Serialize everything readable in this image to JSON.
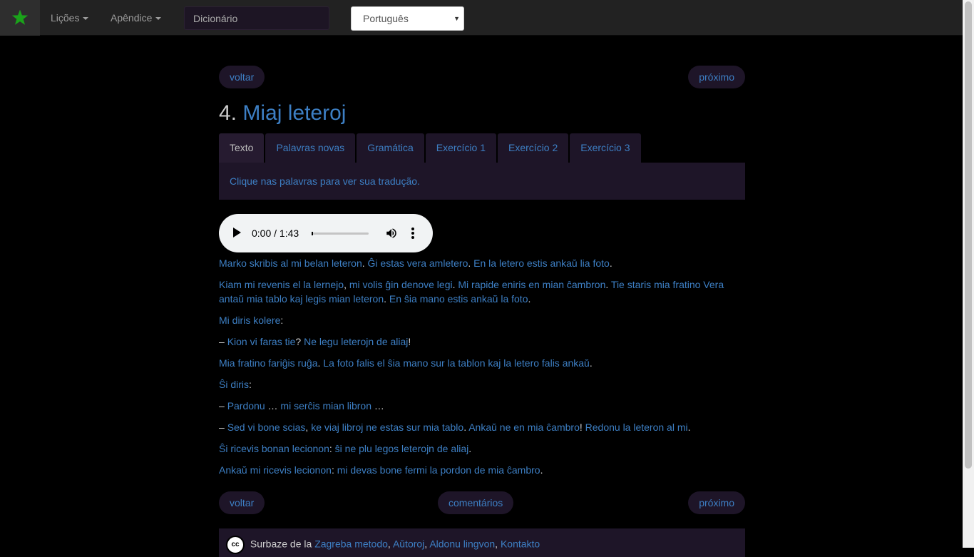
{
  "navbar": {
    "menu1": "Lições",
    "menu2": "Apêndice",
    "dict_placeholder": "Dicionário",
    "lang_selected": "Português"
  },
  "nav": {
    "prev": "voltar",
    "next": "próximo",
    "comments": "comentários"
  },
  "lesson": {
    "number": "4.",
    "title": "Miaj leteroj"
  },
  "tabs": [
    "Texto",
    "Palavras novas",
    "Gramática",
    "Exercício 1",
    "Exercício 2",
    "Exercício 3"
  ],
  "hint": "Clique nas palavras para ver sua tradução.",
  "audio": {
    "time": "0:00 / 1:43"
  },
  "paragraphs": [
    [
      [
        "w",
        "Marko skribis al mi belan leteron"
      ],
      [
        "t",
        "."
      ],
      [
        "t",
        " "
      ],
      [
        "w",
        "Ĝi estas vera amletero"
      ],
      [
        "t",
        "."
      ],
      [
        "t",
        " "
      ],
      [
        "w",
        "En la letero estis ankaŭ lia foto"
      ],
      [
        "t",
        "."
      ]
    ],
    [
      [
        "w",
        "Kiam mi revenis el la lernejo"
      ],
      [
        "t",
        ", "
      ],
      [
        "w",
        "mi volis ĝin denove legi"
      ],
      [
        "t",
        "."
      ],
      [
        "t",
        " "
      ],
      [
        "w",
        "Mi rapide eniris en mian ĉambron"
      ],
      [
        "t",
        "."
      ],
      [
        "t",
        " "
      ],
      [
        "w",
        "Tie staris mia fratino Vera antaŭ mia tablo kaj legis mian leteron"
      ],
      [
        "t",
        "."
      ],
      [
        "t",
        " "
      ],
      [
        "w",
        "En ŝia mano estis ankaŭ la foto"
      ],
      [
        "t",
        "."
      ]
    ],
    [
      [
        "w",
        "Mi diris kolere"
      ],
      [
        "t",
        ":"
      ]
    ],
    [
      [
        "t",
        "– "
      ],
      [
        "w",
        "Kion vi faras tie"
      ],
      [
        "t",
        "? "
      ],
      [
        "w",
        "Ne legu leterojn de aliaj"
      ],
      [
        "t",
        "!"
      ]
    ],
    [
      [
        "w",
        "Mia fratino fariĝis ruĝa"
      ],
      [
        "t",
        ". "
      ],
      [
        "w",
        "La foto falis el ŝia mano sur la tablon kaj la letero falis ankaŭ"
      ],
      [
        "t",
        "."
      ]
    ],
    [
      [
        "w",
        "Ŝi diris"
      ],
      [
        "t",
        ":"
      ]
    ],
    [
      [
        "t",
        "– "
      ],
      [
        "w",
        "Pardonu"
      ],
      [
        "t",
        " … "
      ],
      [
        "w",
        "mi serĉis mian libron"
      ],
      [
        "t",
        " …"
      ]
    ],
    [
      [
        "t",
        "– "
      ],
      [
        "w",
        "Sed vi bone scias"
      ],
      [
        "t",
        ", "
      ],
      [
        "w",
        "ke viaj libroj ne estas sur mia tablo"
      ],
      [
        "t",
        ". "
      ],
      [
        "w",
        "Ankaŭ ne en mia ĉambro"
      ],
      [
        "t",
        "! "
      ],
      [
        "w",
        "Redonu la leteron al mi"
      ],
      [
        "t",
        "."
      ]
    ],
    [
      [
        "w",
        "Ŝi ricevis bonan lecionon"
      ],
      [
        "t",
        ": "
      ],
      [
        "w",
        "ŝi ne plu legos leterojn de aliaj"
      ],
      [
        "t",
        "."
      ]
    ],
    [
      [
        "w",
        "Ankaŭ mi ricevis lecionon"
      ],
      [
        "t",
        ": "
      ],
      [
        "w",
        "mi devas bone fermi la pordon de mia ĉambro"
      ],
      [
        "t",
        "."
      ]
    ]
  ],
  "footer": {
    "cc": "cc",
    "prefix": "Surbaze de la",
    "links": [
      "Zagreba metodo",
      "Aŭtoroj",
      "Aldonu lingvon",
      "Kontakto"
    ]
  },
  "colors": {
    "link": "#3d7fc4",
    "brand_star": "#1aa31a",
    "panel": "#1e1528"
  }
}
